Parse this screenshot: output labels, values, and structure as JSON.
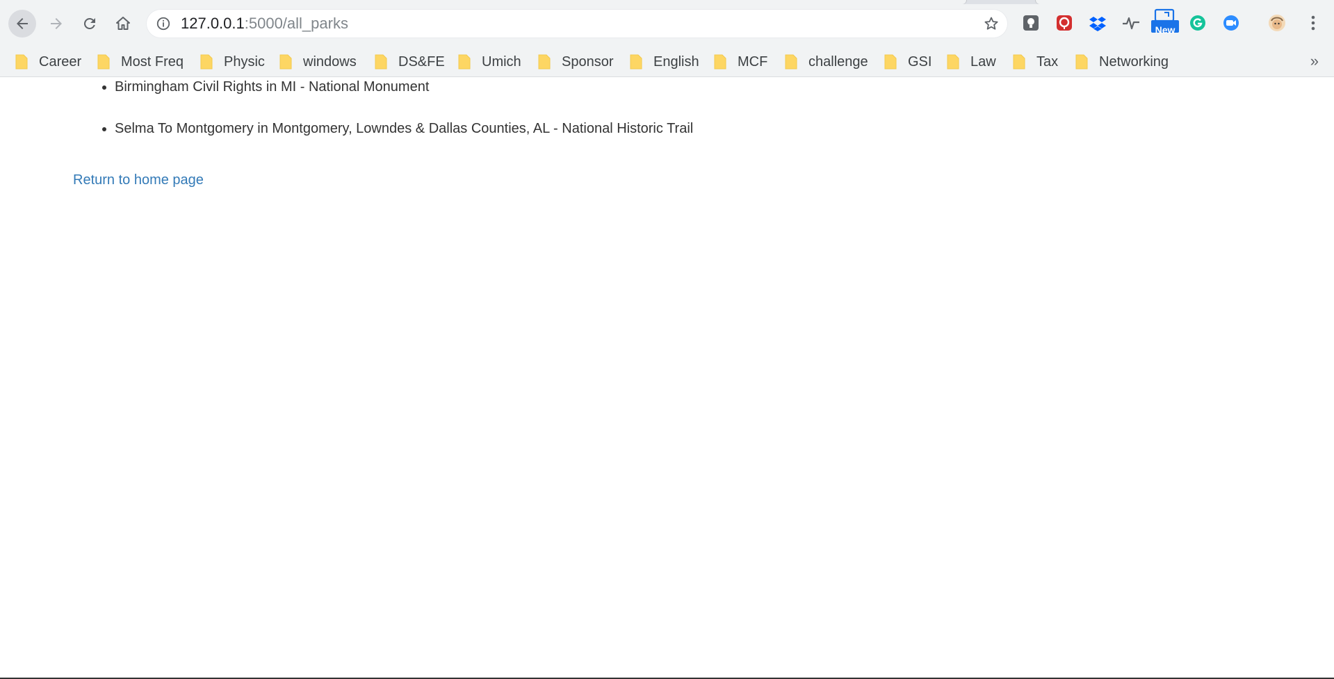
{
  "browser": {
    "url_host": "127.0.0.1",
    "url_path": ":5000/all_parks",
    "nav_icons": [
      "back-arrow-icon",
      "forward-arrow-icon",
      "reload-icon",
      "home-icon"
    ],
    "extensions": [
      {
        "name": "lightbulb-extension-icon",
        "color": "#5f6368"
      },
      {
        "name": "red-extension-icon",
        "color": "#d32f2f"
      },
      {
        "name": "dropbox-icon",
        "color": "#0061ff"
      },
      {
        "name": "pulse-icon",
        "color": "#5f6368"
      },
      {
        "name": "new-badge-extension-icon",
        "color": "#1a73e8",
        "badge": "New"
      },
      {
        "name": "grammarly-icon",
        "color": "#15c39a"
      },
      {
        "name": "zoom-icon",
        "color": "#2d8cff"
      },
      {
        "name": "profile-avatar",
        "color": "#e8b98a"
      },
      {
        "name": "menu-kebab-icon",
        "color": "#5f6368"
      }
    ]
  },
  "bookmarks": {
    "items": [
      {
        "label": "Career"
      },
      {
        "label": "Most Freq"
      },
      {
        "label": "Physic"
      },
      {
        "label": "windows"
      },
      {
        "label": "DS&FE"
      },
      {
        "label": "Umich"
      },
      {
        "label": "Sponsor"
      },
      {
        "label": "English"
      },
      {
        "label": "MCF"
      },
      {
        "label": "challenge"
      },
      {
        "label": "GSI"
      },
      {
        "label": "Law"
      },
      {
        "label": "Tax"
      },
      {
        "label": "Networking"
      }
    ],
    "overflow_label": "»",
    "folder_color": "#fdd663"
  },
  "page": {
    "parks": [
      "Birmingham Civil Rights in MI - National Monument",
      "Selma To Montgomery in Montgomery, Lowndes & Dallas Counties, AL - National Historic Trail"
    ],
    "home_link": "Return to home page",
    "link_color": "#337ab7"
  }
}
